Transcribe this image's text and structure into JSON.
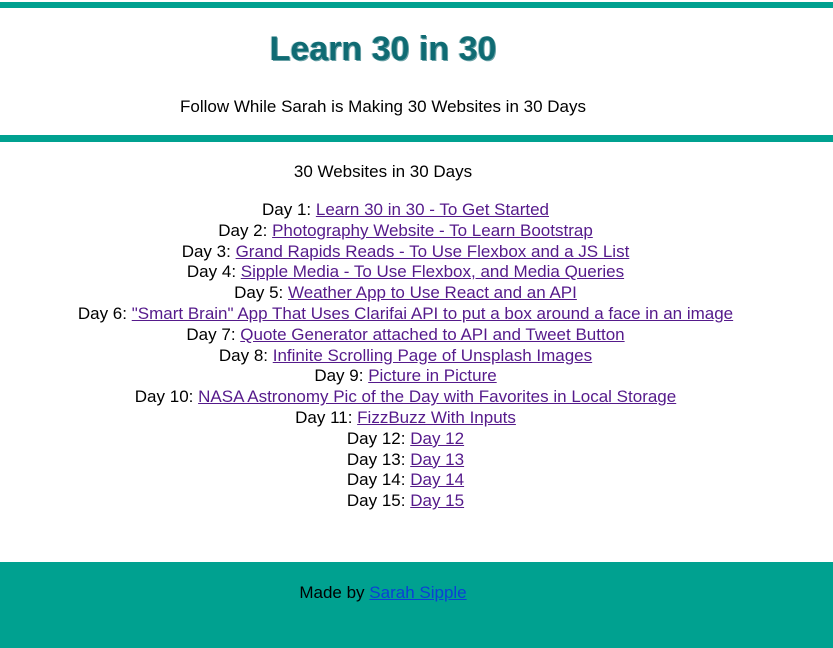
{
  "header": {
    "title": "Learn 30 in 30",
    "subtitle": "Follow While Sarah is Making 30 Websites in 30 Days"
  },
  "main": {
    "heading": "30 Websites in 30 Days",
    "days": [
      {
        "label": "Day 1",
        "link": "Learn 30 in 30 - To Get Started"
      },
      {
        "label": "Day 2",
        "link": "Photography Website - To Learn Bootstrap"
      },
      {
        "label": "Day 3",
        "link": "Grand Rapids Reads - To Use Flexbox and a JS List"
      },
      {
        "label": "Day 4",
        "link": "Sipple Media - To Use Flexbox, and Media Queries"
      },
      {
        "label": "Day 5",
        "link": "Weather App to Use React and an API"
      },
      {
        "label": "Day 6",
        "link": "\"Smart Brain\" App That Uses Clarifai API to put a box around a face in an image"
      },
      {
        "label": "Day 7",
        "link": "Quote Generator attached to API and Tweet Button"
      },
      {
        "label": "Day 8",
        "link": "Infinite Scrolling Page of Unsplash Images"
      },
      {
        "label": "Day 9",
        "link": "Picture in Picture"
      },
      {
        "label": "Day 10",
        "link": "NASA Astronomy Pic of the Day with Favorites in Local Storage"
      },
      {
        "label": "Day 11",
        "link": "FizzBuzz With Inputs"
      },
      {
        "label": "Day 12",
        "link": "Day 12"
      },
      {
        "label": "Day 13",
        "link": "Day 13"
      },
      {
        "label": "Day 14",
        "link": "Day 14"
      },
      {
        "label": "Day 15",
        "link": "Day 15"
      }
    ]
  },
  "footer": {
    "made_by": "Made by",
    "author": "Sarah Sipple"
  },
  "colors": {
    "accent": "#00a190",
    "title": "#0f6b73",
    "visited_link": "#551a8b",
    "link": "#0b3fd6"
  }
}
